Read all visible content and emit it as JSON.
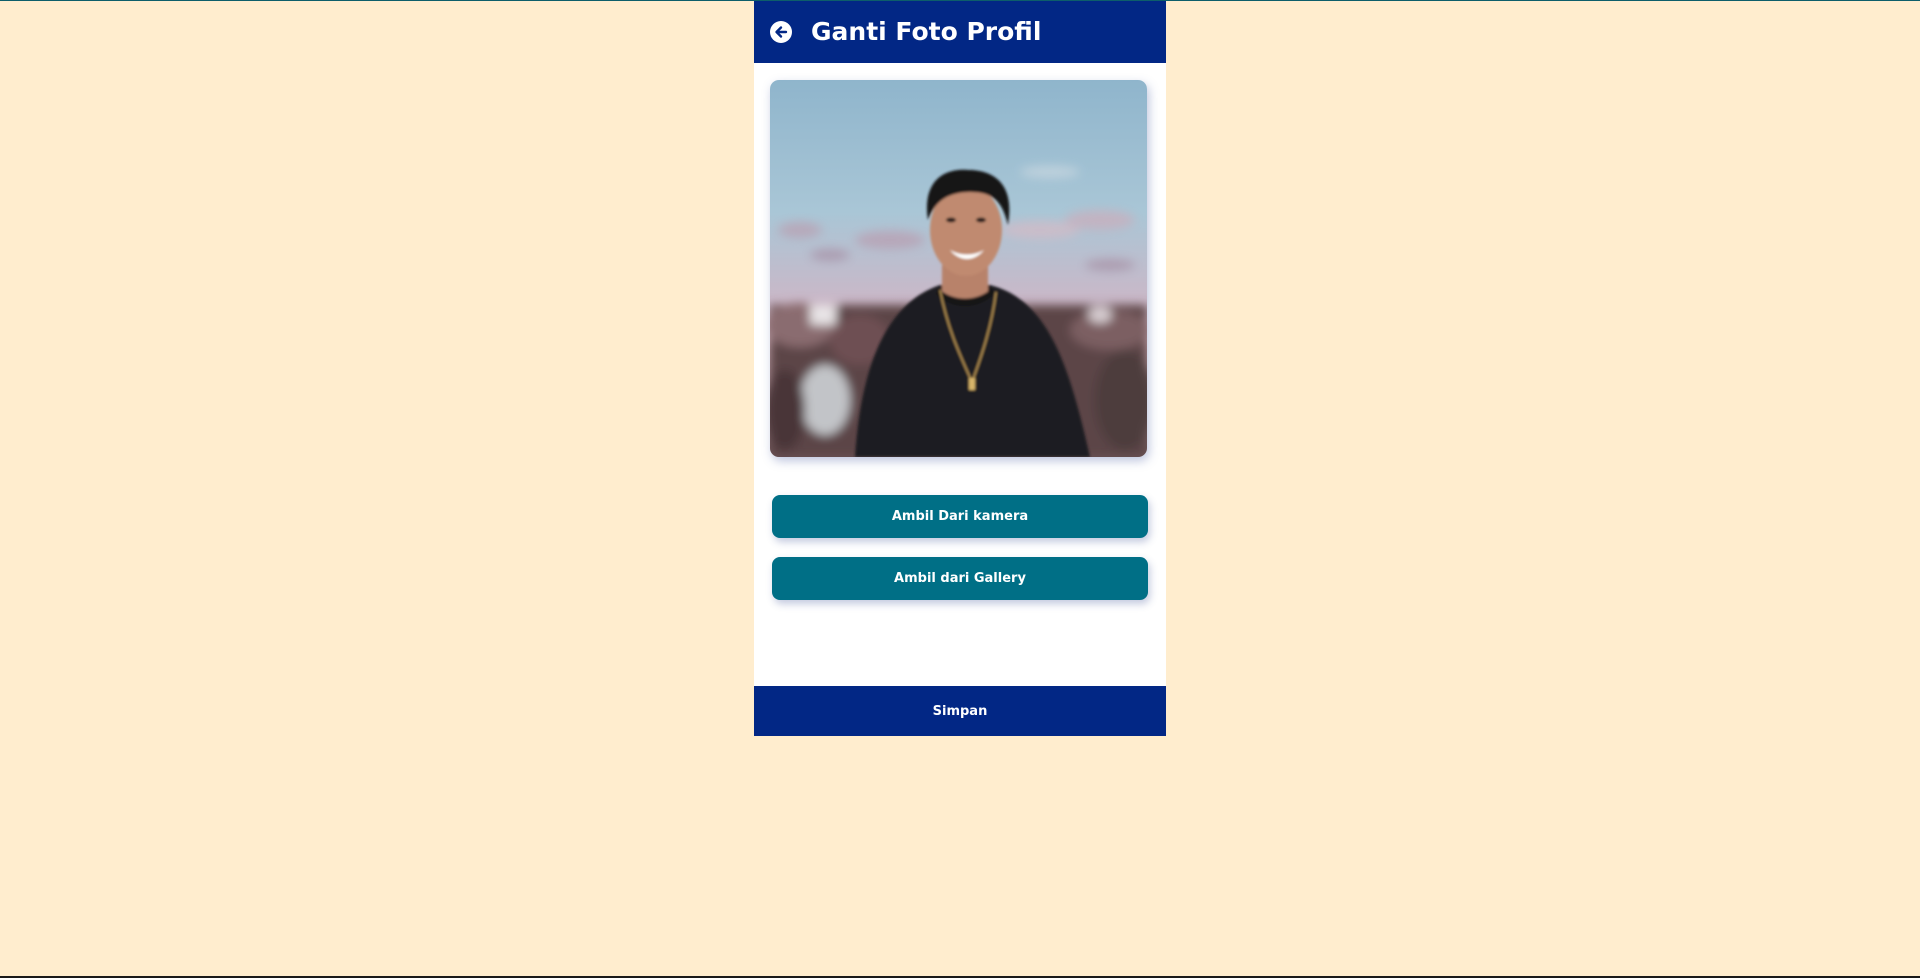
{
  "header": {
    "title": "Ganti Foto Profil",
    "back_icon": "arrow-left-circle-icon"
  },
  "photo": {
    "alt": "profile-photo"
  },
  "actions": {
    "camera_label": "Ambil Dari kamera",
    "gallery_label": "Ambil dari Gallery"
  },
  "footer": {
    "save_label": "Simpan"
  },
  "colors": {
    "page_background": "#FFEDCE",
    "header": "#022785",
    "button": "#006F86",
    "save_bar": "#022785"
  }
}
